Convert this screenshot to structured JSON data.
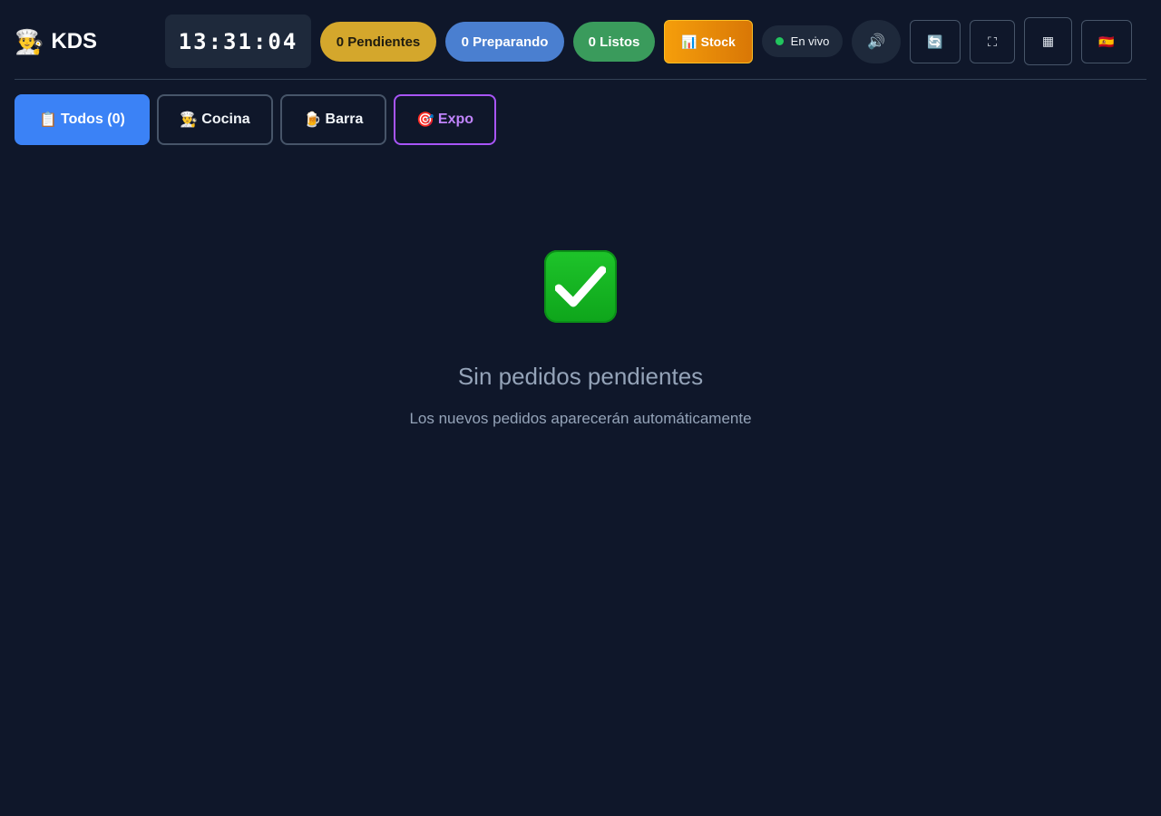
{
  "header": {
    "brand_icon": "chef-icon",
    "brand_emoji": "👨‍🍳",
    "brand_title": "KDS",
    "clock": "13:31:04",
    "counters": {
      "pending_label": "0 Pendientes",
      "preparing_label": "0 Preparando",
      "ready_label": "0 Listos"
    },
    "stock": {
      "emoji": "📊",
      "label": "Stock"
    },
    "live_label": "En vivo",
    "buttons": {
      "sound_emoji": "🔊",
      "refresh_emoji": "🔄",
      "fullscreen_glyph": "⛶",
      "grid_glyph": "▦",
      "language_flag": "🇪🇸"
    }
  },
  "tabs": [
    {
      "emoji": "📋",
      "label": "Todos (0)"
    },
    {
      "emoji": "👨‍🍳",
      "label": "Cocina"
    },
    {
      "emoji": "🍺",
      "label": "Barra"
    },
    {
      "emoji": "🎯",
      "label": "Expo"
    }
  ],
  "empty_state": {
    "icon": "check-mark-icon",
    "title": "Sin pedidos pendientes",
    "subtitle": "Los nuevos pedidos aparecerán automáticamente"
  },
  "colors": {
    "background": "#0f172a",
    "pending": "#d4a72c",
    "preparing": "#4a7fd0",
    "ready": "#3a9b5c",
    "stock": "#f59e0b",
    "active_tab": "#3b82f6",
    "expo_tab": "#a855f7",
    "live_dot": "#22c55e"
  }
}
